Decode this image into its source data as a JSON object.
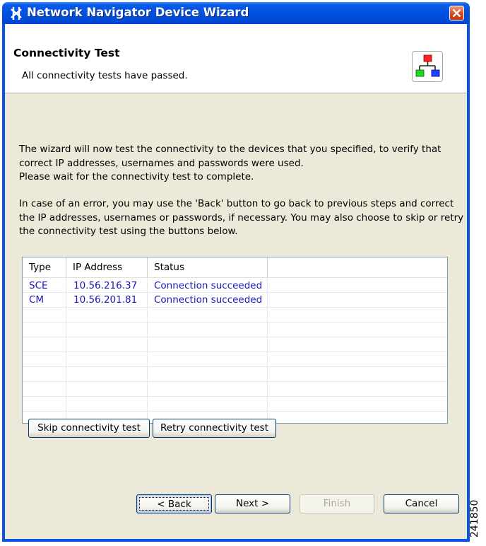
{
  "window": {
    "title": "Network Navigator Device Wizard",
    "close_icon": "close-icon"
  },
  "header": {
    "title": "Connectivity Test",
    "subtitle": "All connectivity tests have passed.",
    "icon": "network-topology-icon"
  },
  "body": {
    "paragraph1": "The wizard will now test the connectivity to the devices that you specified, to verify that correct IP addresses, usernames and passwords were used.\nPlease wait for the connectivity test to complete.",
    "paragraph2": "In case of an error, you may use the 'Back' button to go back to previous steps and correct the IP addresses, usernames or passwords, if necessary. You may also choose to skip or retry the connectivity test using the buttons below."
  },
  "table": {
    "headers": [
      "Type",
      "IP Address",
      "Status"
    ],
    "rows": [
      {
        "type": "SCE",
        "ip": "10.56.216.37",
        "status": "Connection succeeded"
      },
      {
        "type": "CM",
        "ip": "10.56.201.81",
        "status": "Connection succeeded"
      }
    ]
  },
  "buttons": {
    "skip": "Skip connectivity test",
    "retry": "Retry connectivity test",
    "back": "< Back",
    "next": "Next >",
    "finish": "Finish",
    "cancel": "Cancel"
  },
  "figure_number": "241850",
  "colors": {
    "titlebar": "#0a54e0",
    "client": "#ece9d8",
    "table_text": "#1a16b8"
  }
}
